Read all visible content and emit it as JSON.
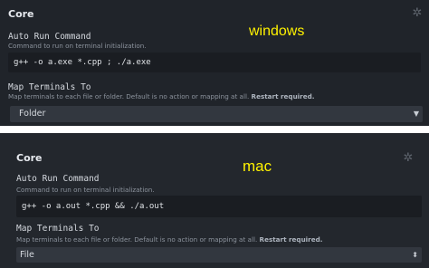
{
  "windows": {
    "section_title": "Core",
    "os_label": "windows",
    "auto_run": {
      "title": "Auto Run Command",
      "description": "Command to run on terminal initialization.",
      "value": "g++ -o a.exe *.cpp ; ./a.exe"
    },
    "map_terminals": {
      "title": "Map Terminals To",
      "description": "Map terminals to each file or folder. Default is no action or mapping at all.",
      "description_bold": "Restart required.",
      "selected": "Folder"
    }
  },
  "mac": {
    "section_title": "Core",
    "os_label": "mac",
    "auto_run": {
      "title": "Auto Run Command",
      "description": "Command to run on terminal initialization.",
      "value": "g++ -o a.out *.cpp && ./a.out"
    },
    "map_terminals": {
      "title": "Map Terminals To",
      "description": "Map terminals to each file or folder. Default is no action or mapping at all.",
      "description_bold": "Restart required.",
      "selected": "File"
    }
  },
  "icons": {
    "settings": "gear-icon",
    "dropdown": "chevron-down-icon"
  },
  "colors": {
    "panel_bg": "#20242a",
    "label_highlight": "#fff200",
    "input_bg": "#1a1d22",
    "select_bg": "#32373f"
  }
}
